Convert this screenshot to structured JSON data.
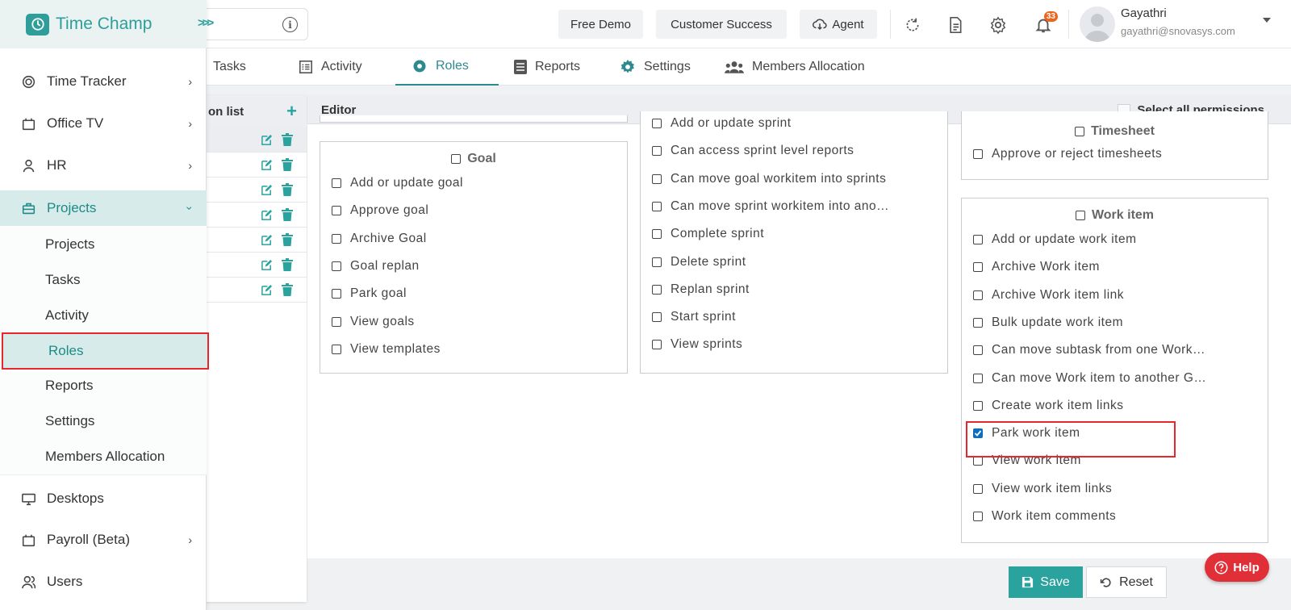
{
  "brand": {
    "name": "Time Champ"
  },
  "header": {
    "free_demo": "Free Demo",
    "customer_success": "Customer Success",
    "agent": "Agent",
    "notification_count": "33",
    "user": {
      "name": "Gayathri",
      "email": "gayathri@snovasys.com"
    }
  },
  "sidebar": {
    "items": [
      {
        "label": "Time Tracker"
      },
      {
        "label": "Office TV"
      },
      {
        "label": "HR"
      },
      {
        "label": "Projects"
      },
      {
        "label": "Desktops"
      },
      {
        "label": "Payroll (Beta)"
      },
      {
        "label": "Users"
      }
    ],
    "sub_items": [
      "Projects",
      "Tasks",
      "Activity",
      "Roles",
      "Reports",
      "Settings",
      "Members Allocation"
    ]
  },
  "tabs": [
    "Tasks",
    "Activity",
    "Roles",
    "Reports",
    "Settings",
    "Members Allocation"
  ],
  "active_tab": "Roles",
  "permission_list": {
    "title": "on list",
    "row_count": 7
  },
  "editor": {
    "title": "Editor",
    "select_all_label": "Select all permissions",
    "goal": {
      "title": "Goal",
      "permissions": [
        "Add or update goal",
        "Approve goal",
        "Archive Goal",
        "Goal replan",
        "Park goal",
        "View goals",
        "View templates"
      ]
    },
    "sprint": {
      "permissions": [
        "Add or update sprint",
        "Can access sprint level reports",
        "Can move goal workitem into sprints",
        "Can move sprint workitem into ano…",
        "Complete sprint",
        "Delete sprint",
        "Replan sprint",
        "Start sprint",
        "View sprints"
      ]
    },
    "timesheet": {
      "title": "Timesheet",
      "permissions": [
        "Approve or reject timesheets"
      ]
    },
    "work_item": {
      "title": "Work item",
      "permissions": [
        "Add or update work item",
        "Archive Work item",
        "Archive Work item link",
        "Bulk update work item",
        "Can move subtask from one Work…",
        "Can move Work item to another G…",
        "Create work item links",
        "Park work item",
        "View work item",
        "View work item links",
        "Work item comments"
      ],
      "checked": [
        "Park work item"
      ]
    }
  },
  "footer": {
    "save": "Save",
    "reset": "Reset",
    "help": "Help"
  }
}
